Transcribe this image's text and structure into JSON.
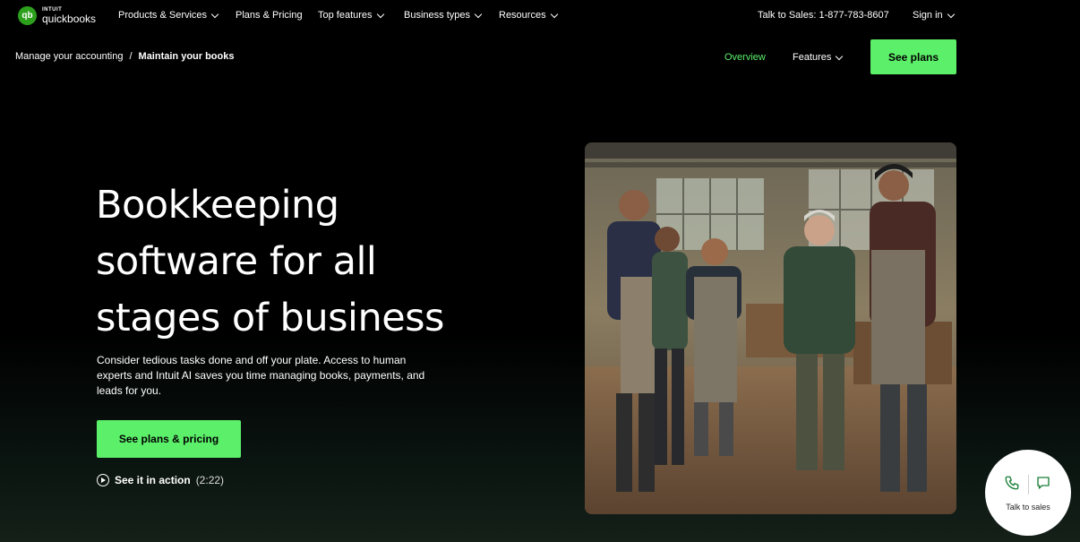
{
  "brand": {
    "intuit": "INTUIT",
    "product": "quickbooks",
    "mark": "qb"
  },
  "topnav": {
    "items": [
      {
        "label": "Products & Services",
        "dropdown": true
      },
      {
        "label": "Plans & Pricing",
        "dropdown": false
      },
      {
        "label": "Top features",
        "dropdown": true
      },
      {
        "label": "Business types",
        "dropdown": true
      },
      {
        "label": "Resources",
        "dropdown": true
      }
    ],
    "sales": "Talk to Sales: 1-877-783-8607",
    "signin": "Sign in"
  },
  "subnav": {
    "breadcrumb": [
      "Manage your accounting",
      "/",
      "Maintain your books"
    ],
    "overview": "Overview",
    "features": "Features",
    "see_plans": "See plans"
  },
  "hero": {
    "title_lines": [
      "Bookkeeping",
      "software for all",
      "stages of business"
    ],
    "description": "Consider tedious tasks done and off your plate. Access to human experts and Intuit AI saves you time managing books, payments, and leads for you.",
    "cta": "See plans & pricing",
    "video_label": "See it in action",
    "video_duration": "(2:22)"
  },
  "widget": {
    "label": "Talk to sales"
  },
  "colors": {
    "accent": "#5cf06a",
    "brand_green": "#2ca01c",
    "background": "#000000"
  }
}
